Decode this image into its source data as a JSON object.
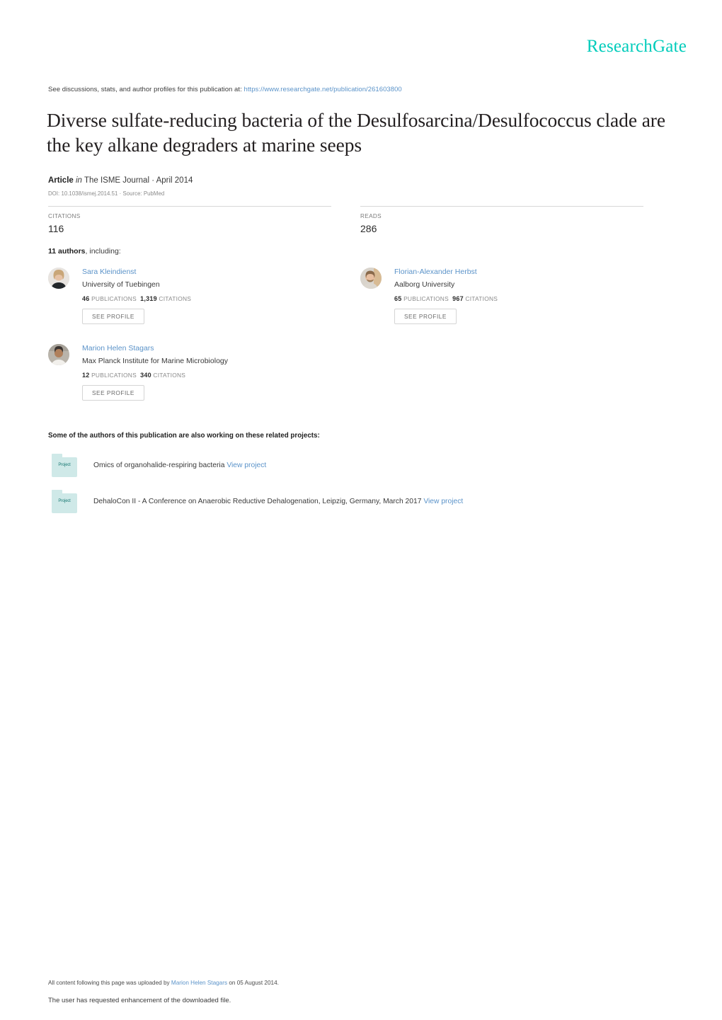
{
  "brand": {
    "name": "ResearchGate",
    "color": "#00ccbb"
  },
  "discussions": {
    "prefix": "See discussions, stats, and author profiles for this publication at:",
    "url": "https://www.researchgate.net/publication/261603800"
  },
  "publication": {
    "title": "Diverse sulfate-reducing bacteria of the Desulfosarcina/Desulfococcus clade are the key alkane degraders at marine seeps",
    "type_label": "Article",
    "in_label": "in",
    "venue": "The ISME Journal · April 2014",
    "doi_line": "DOI: 10.1038/ismej.2014.51 · Source: PubMed"
  },
  "stats": {
    "citations_label": "CITATIONS",
    "citations_value": "116",
    "reads_label": "READS",
    "reads_value": "286"
  },
  "authors_section": {
    "count_label": "11 authors",
    "including_label": ", including:",
    "see_profile_label": "SEE PROFILE",
    "publications_label": "PUBLICATIONS",
    "citations_label": "CITATIONS",
    "authors": [
      {
        "name": "Sara Kleindienst",
        "institution": "University of Tuebingen",
        "publications": "46",
        "citations": "1,319"
      },
      {
        "name": "Florian-Alexander Herbst",
        "institution": "Aalborg University",
        "publications": "65",
        "citations": "967"
      },
      {
        "name": "Marion Helen Stagars",
        "institution": "Max Planck Institute for Marine Microbiology",
        "publications": "12",
        "citations": "340"
      }
    ]
  },
  "projects_section": {
    "heading": "Some of the authors of this publication are also working on these related projects:",
    "folder_label": "Project",
    "view_label": "View project",
    "projects": [
      {
        "title": "Omics of organohalide-respiring bacteria"
      },
      {
        "title": "DehaloCon II - A Conference on Anaerobic Reductive Dehalogenation, Leipzig, Germany, March 2017"
      }
    ]
  },
  "footer": {
    "uploaded_prefix": "All content following this page was uploaded by",
    "uploaded_by": "Marion Helen Stagars",
    "uploaded_suffix": "on 05 August 2014.",
    "enhancement_note": "The user has requested enhancement of the downloaded file."
  }
}
